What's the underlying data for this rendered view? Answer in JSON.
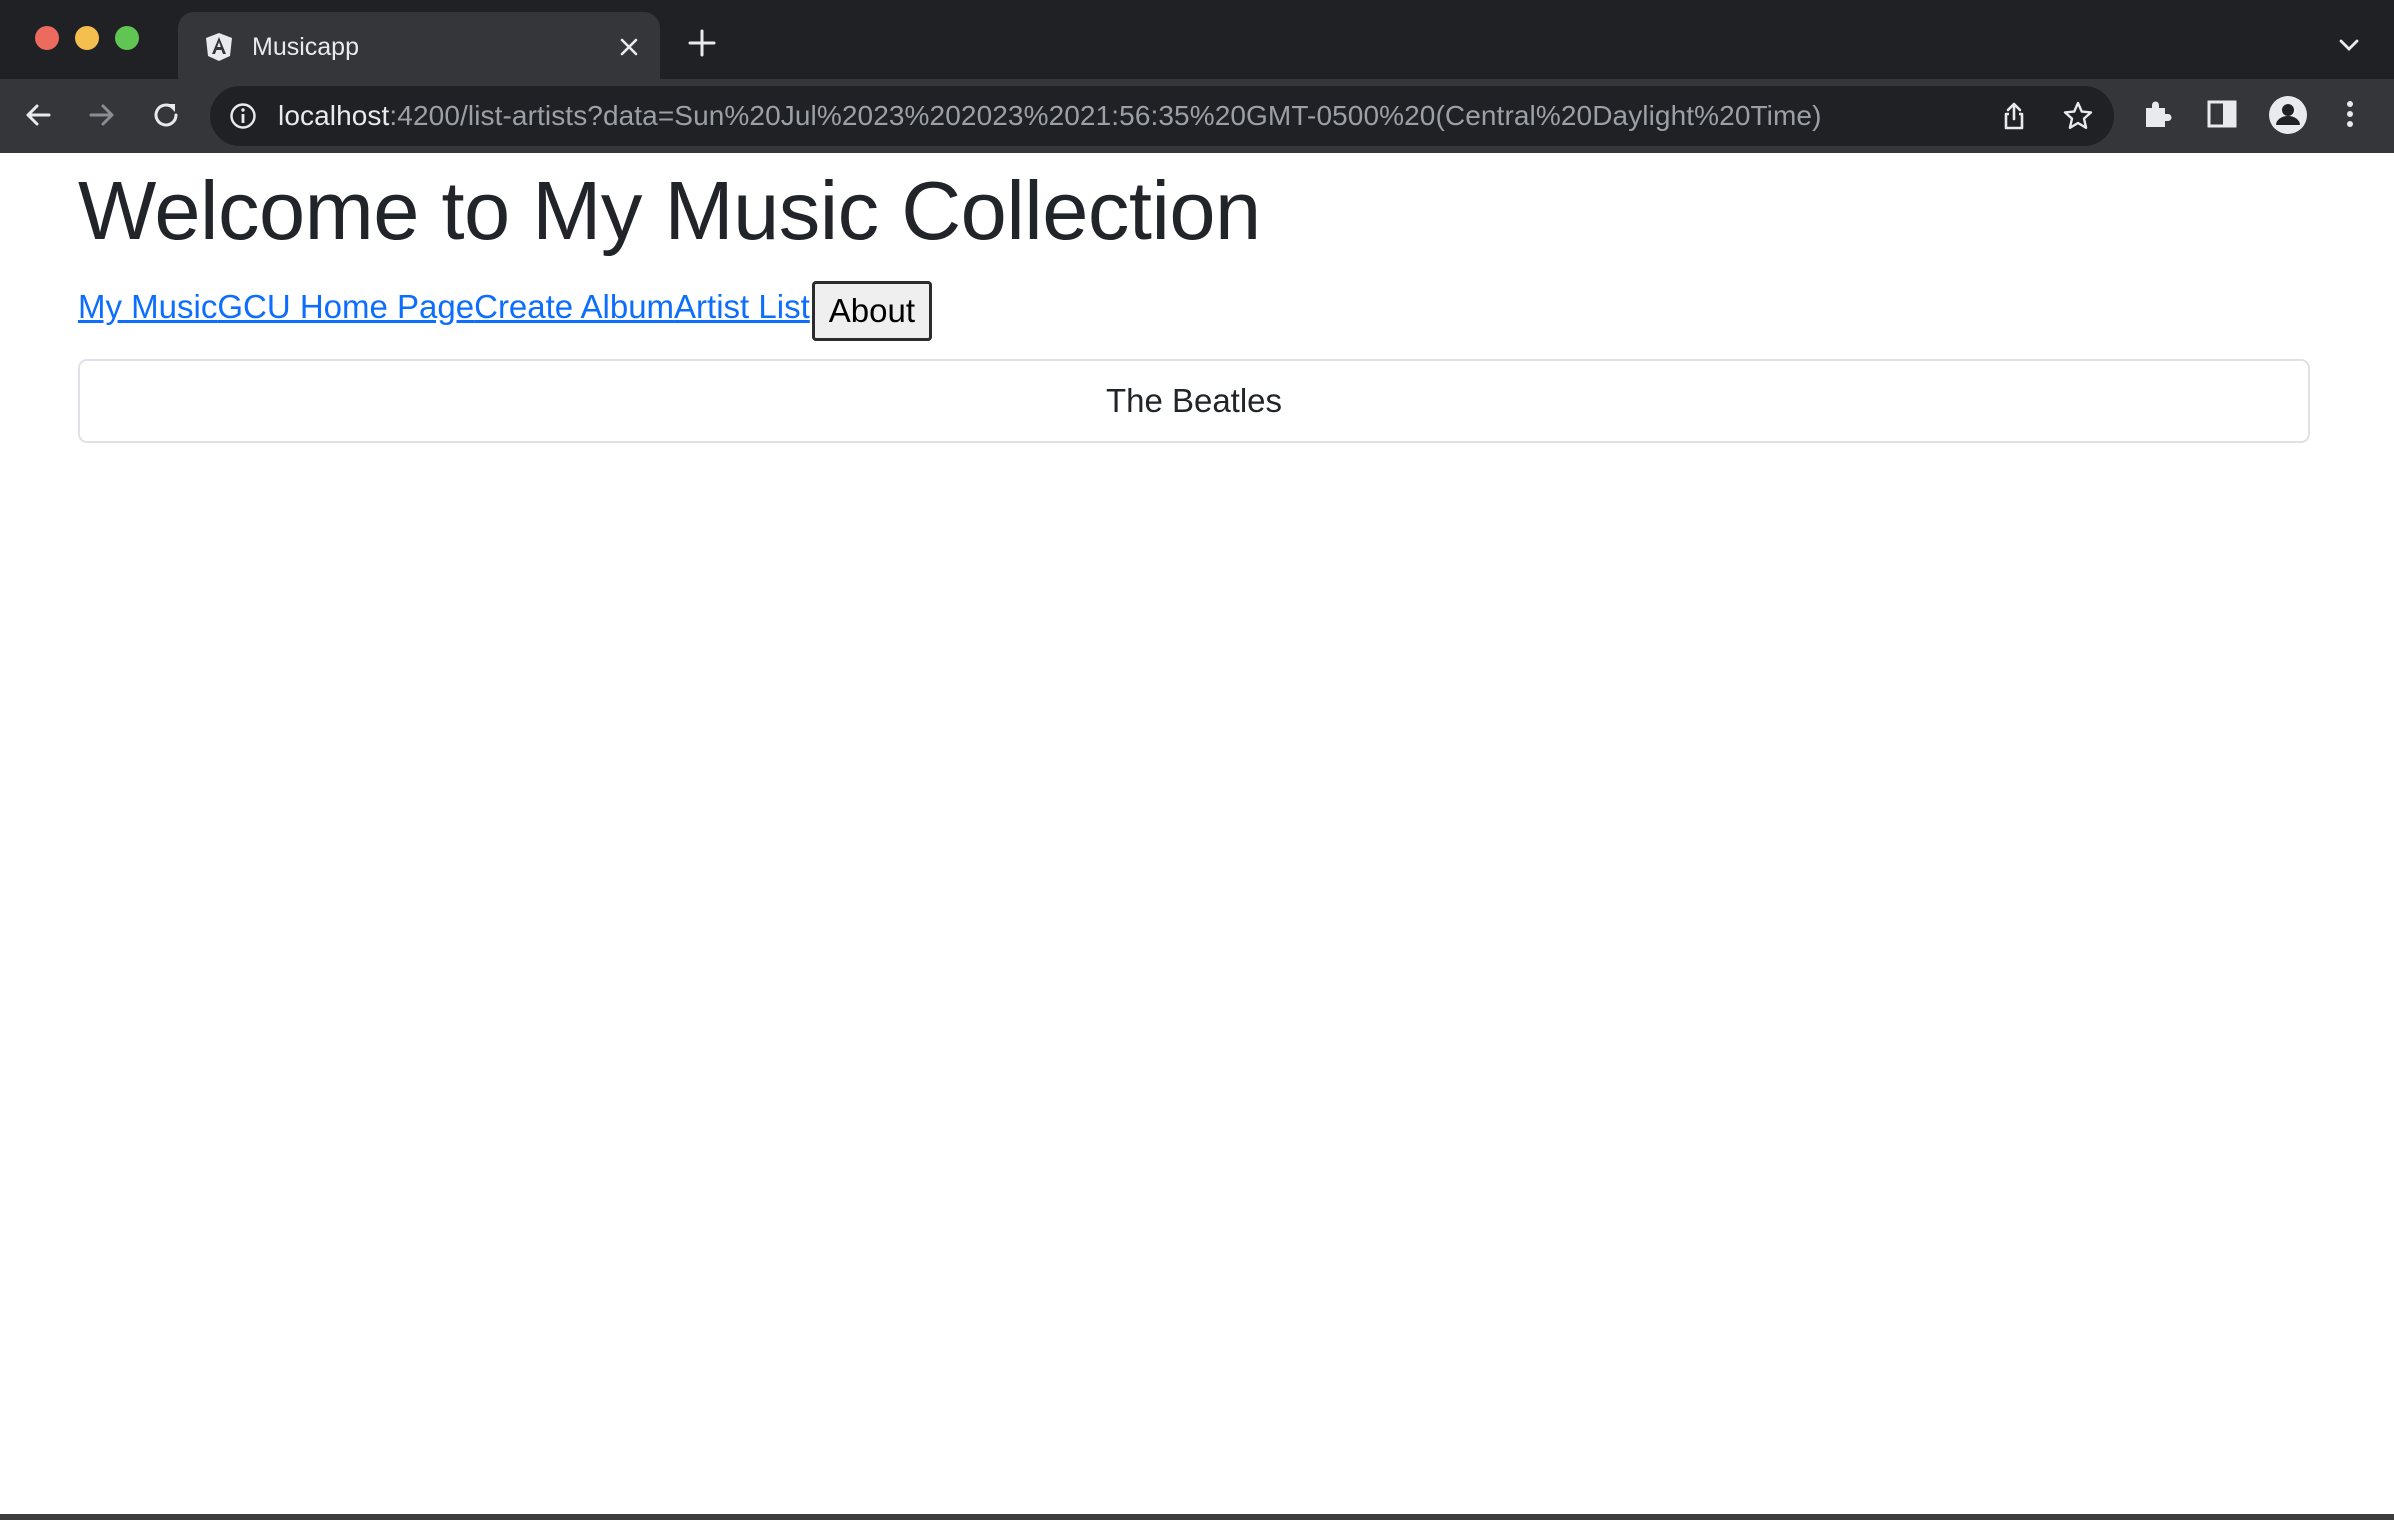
{
  "browser": {
    "tab": {
      "title": "Musicapp",
      "favicon": "angular-icon"
    },
    "url": {
      "host": "localhost",
      "rest": ":4200/list-artists?data=Sun%20Jul%2023%202023%2021:56:35%20GMT-0500%20(Central%20Daylight%20Time)"
    },
    "colors": {
      "frame": "#202124",
      "toolbar": "#35363a",
      "omnibox": "#202124"
    }
  },
  "page": {
    "title": "Welcome to My Music Collection",
    "nav": {
      "links": [
        "My Music",
        "GCU Home Page",
        "Create Album",
        "Artist List"
      ],
      "about_button": "About"
    },
    "artists": [
      "The Beatles"
    ],
    "colors": {
      "link": "#0d6efd",
      "text": "#212529",
      "border": "#dee2e6"
    }
  }
}
